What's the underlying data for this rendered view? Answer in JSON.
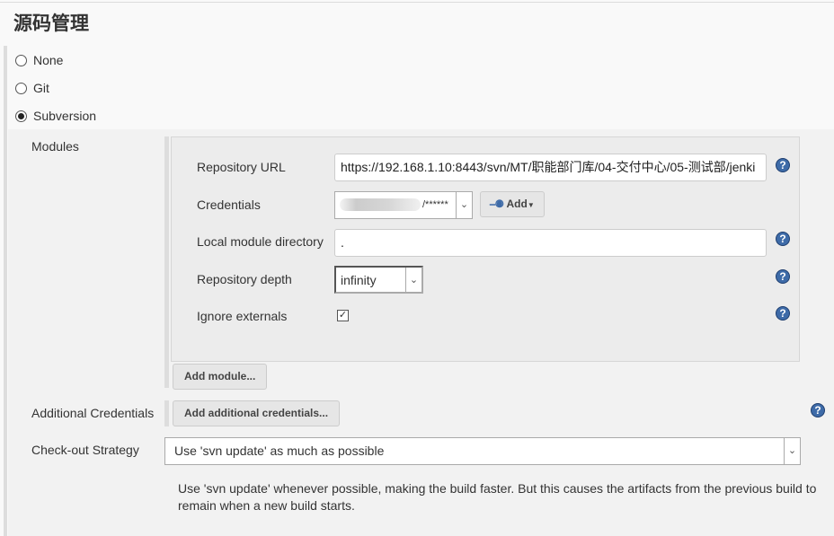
{
  "section_title": "源码管理",
  "scm_options": [
    {
      "label": "None",
      "selected": false
    },
    {
      "label": "Git",
      "selected": false
    },
    {
      "label": "Subversion",
      "selected": true
    }
  ],
  "modules": {
    "label": "Modules",
    "repository_url_label": "Repository URL",
    "repository_url": "https://192.168.1.10:8443/svn/MT/职能部门库/04-交付中心/05-测试部/jenki",
    "credentials_label": "Credentials",
    "credentials_value": "/******",
    "add_label": "Add",
    "local_dir_label": "Local module directory",
    "local_dir": ".",
    "depth_label": "Repository depth",
    "depth": "infinity",
    "ignore_externals_label": "Ignore externals",
    "ignore_externals": true,
    "add_module": "Add module..."
  },
  "additional_credentials": {
    "label": "Additional Credentials",
    "button": "Add additional credentials..."
  },
  "checkout": {
    "label": "Check-out Strategy",
    "value": "Use 'svn update' as much as possible",
    "description": "Use 'svn update' whenever possible, making the build faster. But this causes the artifacts from the previous build to remain when a new build starts."
  },
  "help_glyph": "?"
}
